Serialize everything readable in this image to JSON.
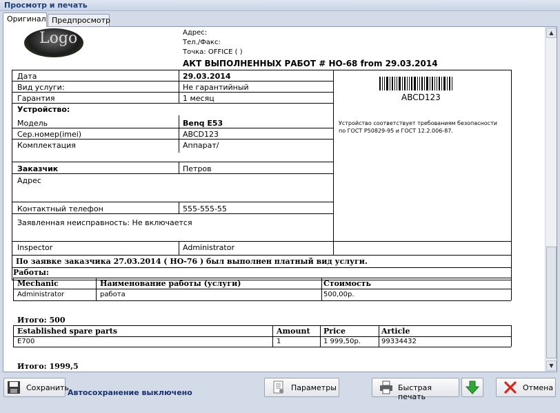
{
  "window": {
    "title": "Просмотр и печать"
  },
  "tabs": [
    "Оригинал",
    "Предпросмотр"
  ],
  "doc": {
    "logo_text": "Logo",
    "address_label": "Адрес:",
    "phone_fax_label": "Тел./Факс:",
    "point_label": "Точка: OFFICE  (  )",
    "title": "АКТ ВЫПОЛНЕННЫХ РАБОТ # НО-68    from 29.03.2014",
    "rows": {
      "date_label": "Дата",
      "date_value": "29.03.2014",
      "service_label": "Вид услуги:",
      "service_value": "Не гарантийный",
      "warranty_label": "Гарантия",
      "warranty_value": "1 месяц",
      "device_label": "Устройство:",
      "model_label": "Модель",
      "model_value": "Benq E53",
      "serial_label": "Сер.номер(imei)",
      "serial_value": "ABCD123",
      "kit_label": "Комплектация",
      "kit_value": "Аппарат/",
      "customer_label": "Заказчик",
      "customer_value": "Петров",
      "address_label": "Адрес",
      "contact_label": "Контактный телефон",
      "contact_value": "555-555-55",
      "fault_label": "Заявленная неисправность: Не включается",
      "inspector_label": "Inspector",
      "inspector_value": "Administrator"
    },
    "barcode_text": "ABCD123",
    "safety_text_1": "Устройство соответствует требованиям безопасности",
    "safety_text_2": "по ГОСТ Р50829-95 и ГОСТ 12.2.006-87.",
    "summary": "По заявке заказчика  27.03.2014 ( НО-76 ) был выполнен платный вид услуги.",
    "works_label": "Работы:",
    "works": {
      "headers": [
        "Mechanic",
        "Наименование работы (услуги)",
        "Стоимость"
      ],
      "row": [
        "Administrator",
        "работа",
        "500,00р."
      ]
    },
    "total_1": "Итого: 500",
    "parts": {
      "headers": [
        "Established spare parts",
        "Amount",
        "Price",
        "Article"
      ],
      "row": [
        "E700",
        "1",
        "1 999,50р.",
        "99334432"
      ]
    },
    "total_2": "Итого: 1999,5"
  },
  "toolbar": {
    "save": "Сохранить",
    "autosave": "Автосохранение выключено",
    "params": "Параметры",
    "quick_print": "Быстрая печать",
    "cancel": "Отмена"
  }
}
